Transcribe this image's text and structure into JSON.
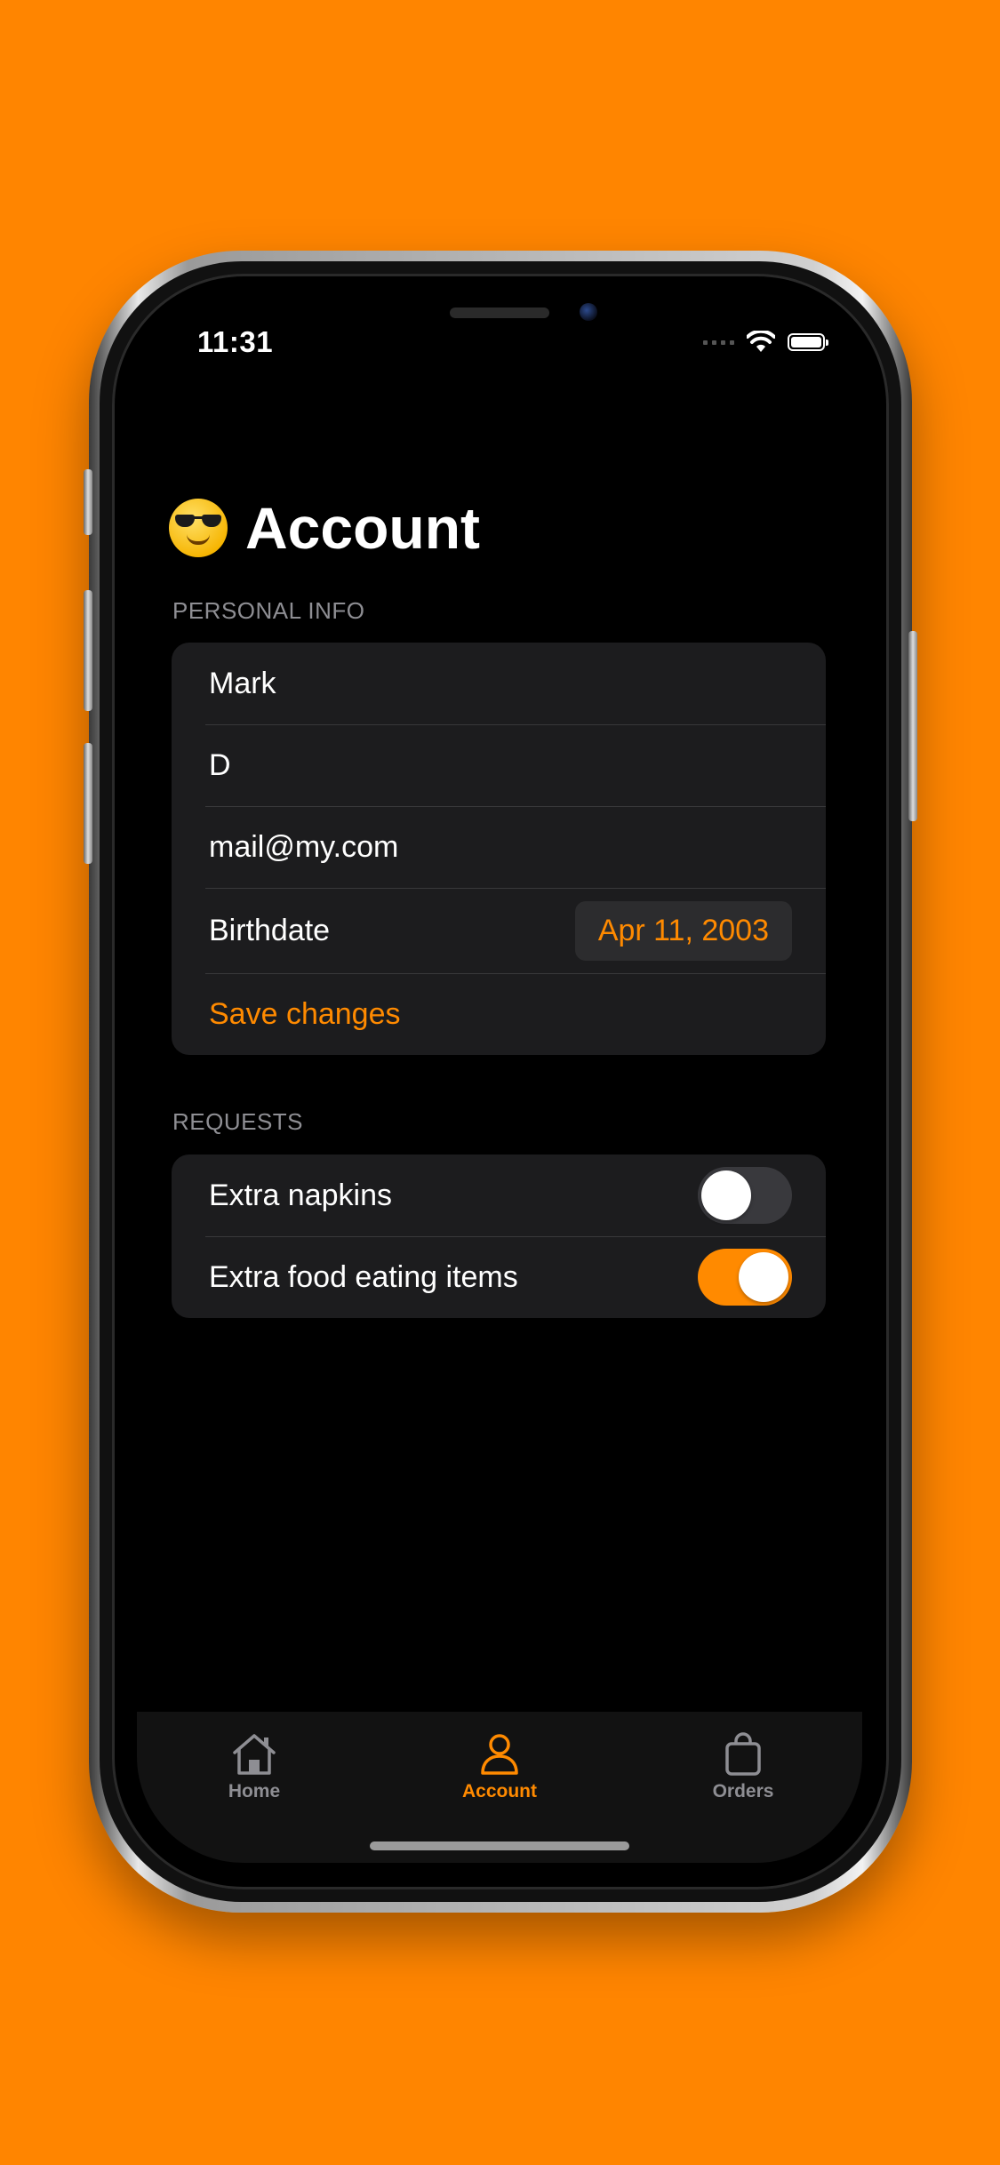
{
  "status_bar": {
    "time": "11:31"
  },
  "header": {
    "emoji": "sunglasses-face",
    "title": "Account"
  },
  "personal_info": {
    "section_title": "PERSONAL INFO",
    "first_name": "Mark",
    "last_name": "D",
    "email": "mail@my.com",
    "birthdate_label": "Birthdate",
    "birthdate_value": "Apr 11, 2003",
    "save_label": "Save changes"
  },
  "requests": {
    "section_title": "REQUESTS",
    "items": [
      {
        "label": "Extra napkins",
        "enabled": false
      },
      {
        "label": "Extra food eating items",
        "enabled": true
      }
    ]
  },
  "tab_bar": {
    "tabs": [
      {
        "label": "Home",
        "icon": "house-icon",
        "active": false
      },
      {
        "label": "Account",
        "icon": "person-icon",
        "active": true
      },
      {
        "label": "Orders",
        "icon": "bag-icon",
        "active": false
      }
    ]
  },
  "colors": {
    "background": "#FF8500",
    "accent": "#FF8A00",
    "card": "#1c1c1e"
  }
}
